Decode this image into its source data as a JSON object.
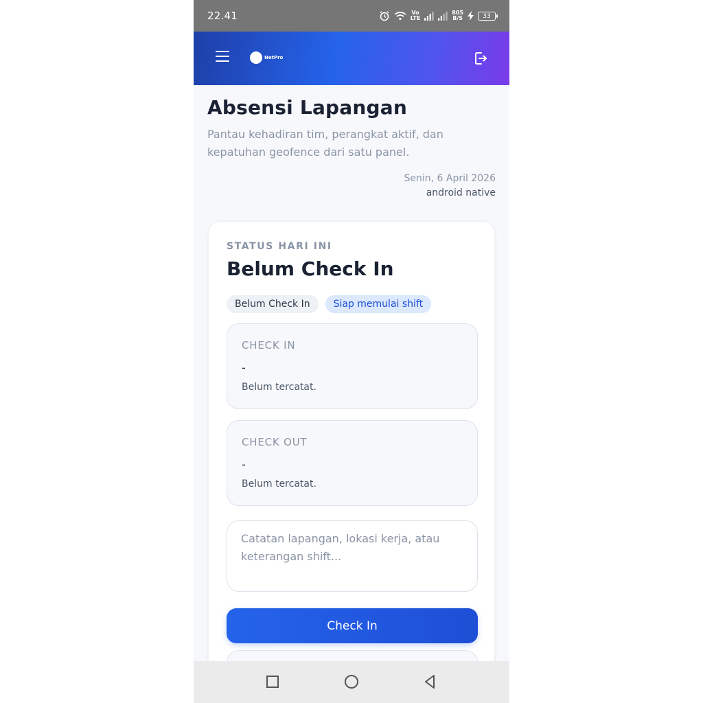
{
  "status_bar": {
    "time": "22.41",
    "lte_top": "Vo",
    "lte_bottom": "LTE",
    "speed_top": "805",
    "speed_bottom": "B/S",
    "battery": "33"
  },
  "header": {
    "logo_text": "NetPro",
    "menu_icon": "hamburger-menu-icon",
    "logout_icon": "logout-icon"
  },
  "page": {
    "title": "Absensi Lapangan",
    "subtitle": "Pantau kehadiran tim, perangkat aktif, dan kepatuhan geofence dari satu panel.",
    "date": "Senin, 6 April 2026",
    "platform": "android native"
  },
  "status_card": {
    "kicker": "STATUS HARI INI",
    "title": "Belum Check In",
    "chips": [
      "Belum Check In",
      "Siap memulai shift"
    ],
    "check_in": {
      "label": "CHECK IN",
      "value": "-",
      "desc": "Belum tercatat."
    },
    "check_out": {
      "label": "CHECK OUT",
      "value": "-",
      "desc": "Belum tercatat."
    },
    "notes_placeholder": "Catatan lapangan, lokasi kerja, atau keterangan shift...",
    "button_label": "Check In"
  },
  "colors": {
    "primary": "#2563eb",
    "header_gradient_end": "#7a3bea",
    "text_dark": "#1a2233",
    "text_muted": "#8a94a6"
  }
}
